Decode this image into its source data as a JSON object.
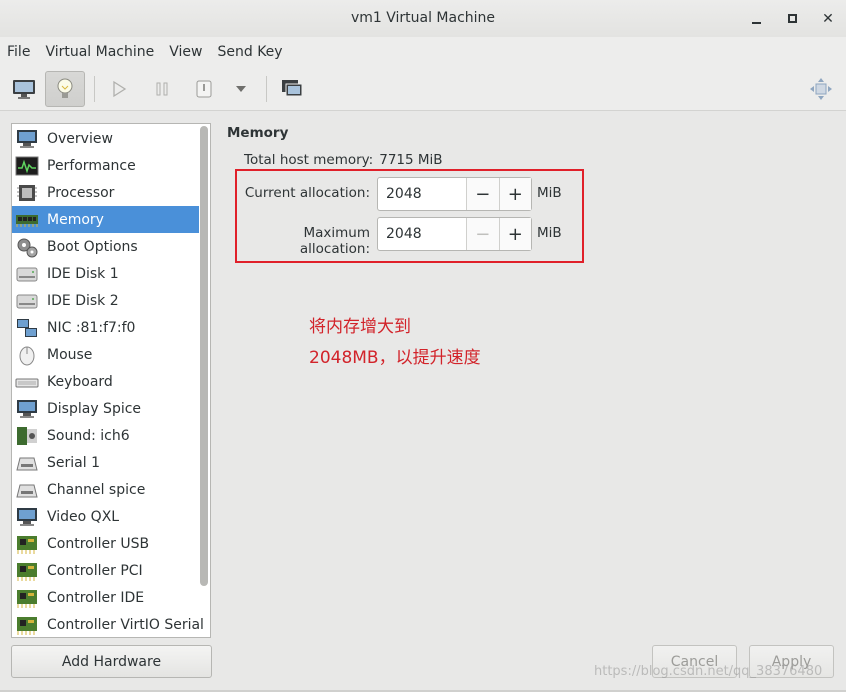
{
  "window": {
    "title": "vm1 Virtual Machine"
  },
  "menu": [
    "File",
    "Virtual Machine",
    "View",
    "Send Key"
  ],
  "toolbar": {
    "icons": [
      "monitor-icon",
      "lightbulb-icon",
      "play-icon",
      "pause-icon",
      "power-icon",
      "dropdown-arrow-icon",
      "snapshot-icon",
      "fullscreen-move-icon"
    ]
  },
  "sidebar": {
    "items": [
      {
        "label": "Overview",
        "icon": "monitor-icon"
      },
      {
        "label": "Performance",
        "icon": "performance-graph-icon"
      },
      {
        "label": "Processor",
        "icon": "cpu-chip-icon"
      },
      {
        "label": "Memory",
        "icon": "memory-module-icon",
        "selected": true
      },
      {
        "label": "Boot Options",
        "icon": "gears-icon"
      },
      {
        "label": "IDE Disk 1",
        "icon": "disk-drive-icon"
      },
      {
        "label": "IDE Disk 2",
        "icon": "disk-drive-icon"
      },
      {
        "label": "NIC :81:f7:f0",
        "icon": "network-icon"
      },
      {
        "label": "Mouse",
        "icon": "mouse-icon"
      },
      {
        "label": "Keyboard",
        "icon": "keyboard-icon"
      },
      {
        "label": "Display Spice",
        "icon": "monitor-icon"
      },
      {
        "label": "Sound: ich6",
        "icon": "sound-card-icon"
      },
      {
        "label": "Serial 1",
        "icon": "serial-port-icon"
      },
      {
        "label": "Channel spice",
        "icon": "serial-port-icon"
      },
      {
        "label": "Video QXL",
        "icon": "monitor-icon"
      },
      {
        "label": "Controller USB",
        "icon": "controller-card-icon"
      },
      {
        "label": "Controller PCI",
        "icon": "controller-card-icon"
      },
      {
        "label": "Controller IDE",
        "icon": "controller-card-icon"
      },
      {
        "label": "Controller VirtIO Serial",
        "icon": "controller-card-icon"
      }
    ],
    "add_hardware": "Add Hardware"
  },
  "memory": {
    "section_title": "Memory",
    "host_label": "Total host memory:",
    "host_value": "7715 MiB",
    "current_label": "Current allocation:",
    "current_value": "2048",
    "max_label": "Maximum allocation:",
    "max_value": "2048",
    "unit": "MiB",
    "minus": "−",
    "plus": "+"
  },
  "annotation": {
    "color": "#d2232a",
    "text": "将内存增大到2048MB，以提升速度"
  },
  "footer": {
    "cancel": "Cancel",
    "apply": "Apply",
    "watermark": "https://blog.csdn.net/qq_38376480"
  },
  "colors": {
    "selection": "#4a90d9",
    "highlight_box": "#e0202a"
  }
}
